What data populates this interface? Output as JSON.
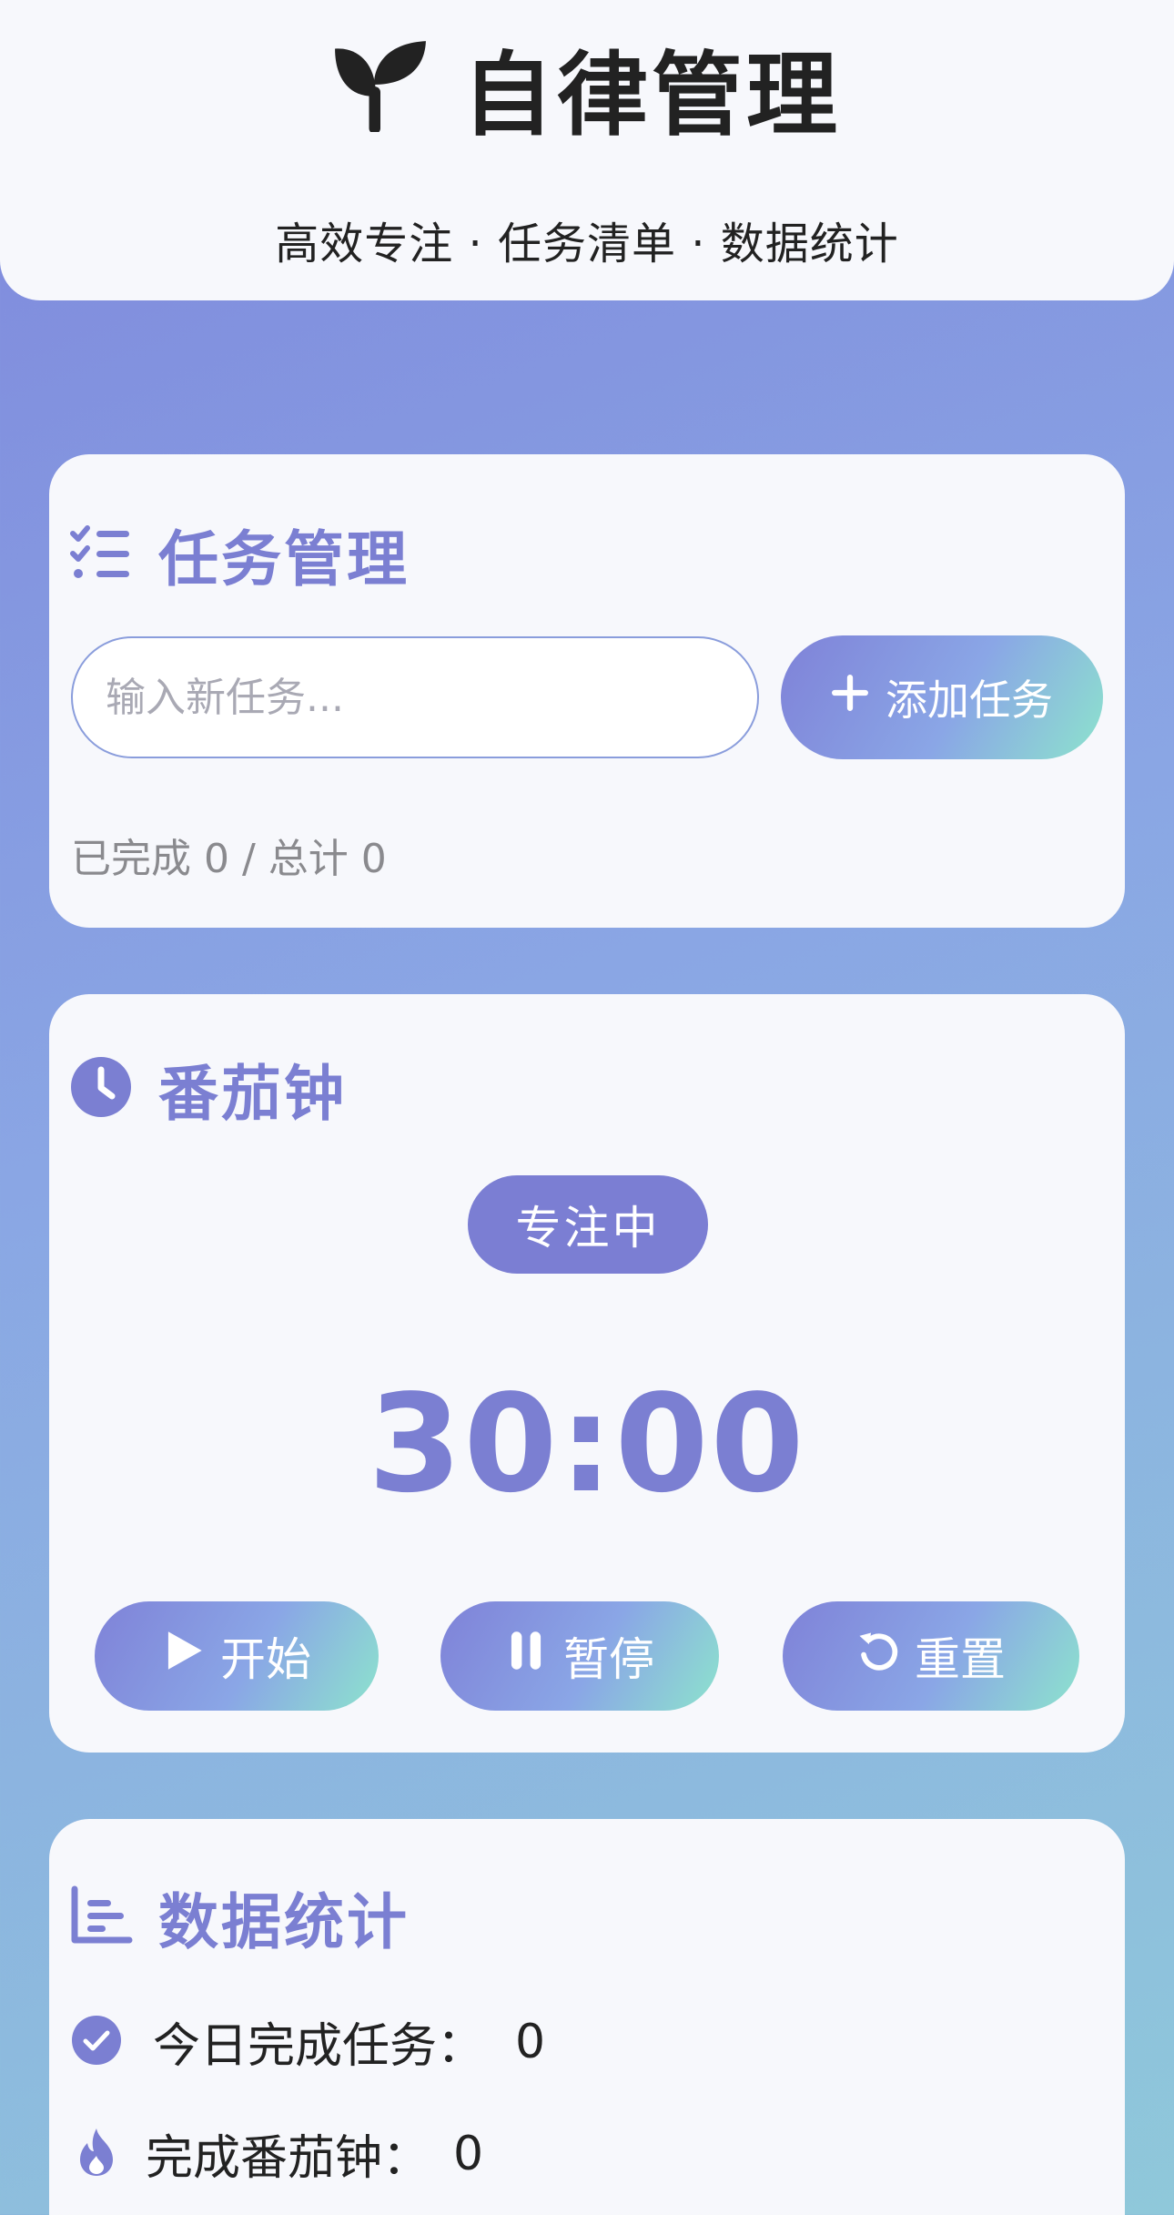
{
  "header": {
    "title": "自律管理",
    "subtitle": "高效专注 · 任务清单 · 数据统计",
    "logo_icon": "sprout-icon"
  },
  "tasks": {
    "title": "任务管理",
    "icon": "checklist-icon",
    "input_placeholder": "输入新任务...",
    "input_value": "",
    "add_button_label": "添加任务",
    "progress_text": "已完成 0 / 总计 0"
  },
  "pomodoro": {
    "title": "番茄钟",
    "icon": "clock-icon",
    "mode_label": "专注中",
    "time_display": "30:00",
    "start_label": "开始",
    "pause_label": "暂停",
    "reset_label": "重置"
  },
  "stats": {
    "title": "数据统计",
    "icon": "bar-chart-icon",
    "items": [
      {
        "label": "今日完成任务：",
        "value": "0",
        "icon": "check-circle-icon"
      },
      {
        "label": "完成番茄钟：",
        "value": "0",
        "icon": "fire-icon"
      }
    ]
  },
  "colors": {
    "accent": "#7b7fd2",
    "badge": "#7b7ed3",
    "card_bg": "#f7f8fc",
    "gradient_start": "#7f82d8",
    "gradient_end": "#8de3cd"
  }
}
